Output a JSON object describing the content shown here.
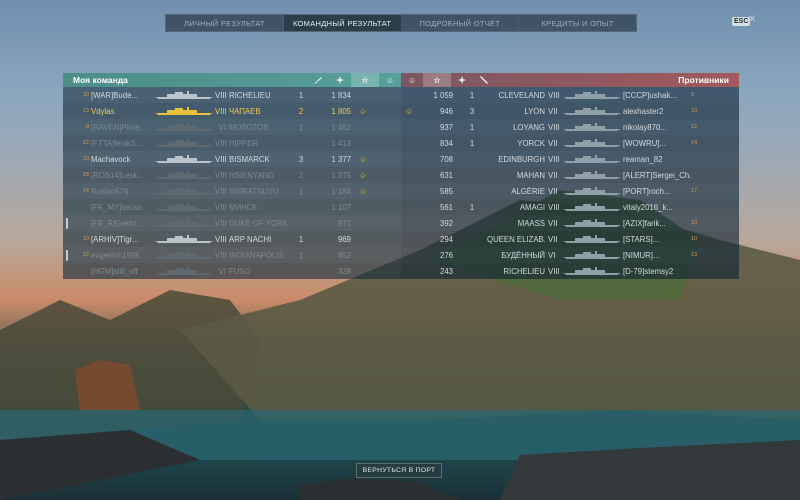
{
  "tabs": [
    "Личный результат",
    "Командный результат",
    "Подробный отчёт",
    "Кредиты и опыт"
  ],
  "esc_label": "ESC",
  "close_glyph": "✕",
  "colors": {
    "ally": "#57a09a",
    "enemy": "#a15a5e",
    "me": "#f0c94b"
  },
  "icons": {
    "kills": "torpedo-icon",
    "planes": "plane-icon",
    "xp": "star-icon",
    "medal": "medal-icon"
  },
  "my_team": {
    "title": "Моя команда",
    "rows": [
      {
        "level": "10",
        "player": "[WAR]Bude...",
        "tier": "VIII",
        "ship": "RICHELIEU",
        "kills": "1",
        "xp": "1 834",
        "medal": "",
        "me": false,
        "dead": false,
        "shield": false
      },
      {
        "level": "13",
        "player": "Vdylas",
        "tier": "VIII",
        "ship": "ЧАПАЕВ",
        "kills": "2",
        "xp": "1 805",
        "medal": "☺",
        "me": true,
        "dead": false,
        "shield": false
      },
      {
        "level": "8",
        "player": "[RAVEN]Piote...",
        "tier": "VI",
        "ship": "МОЛОТОВ",
        "kills": "1",
        "xp": "1 462",
        "medal": "",
        "me": false,
        "dead": true,
        "shield": false
      },
      {
        "level": "12",
        "player": "[FTTA]fenikS...",
        "tier": "VIII",
        "ship": "HIPPER",
        "kills": "",
        "xp": "1 413",
        "medal": "",
        "me": false,
        "dead": true,
        "shield": false
      },
      {
        "level": "10",
        "player": "Machavock",
        "tier": "VIII",
        "ship": "BISMARCK",
        "kills": "3",
        "xp": "1 377",
        "medal": "☺",
        "me": false,
        "dead": false,
        "shield": false
      },
      {
        "level": "15",
        "player": "[ROS14]Lesk...",
        "tier": "VIII",
        "ship": "HSIENYANG",
        "kills": "2",
        "xp": "1 275",
        "medal": "☺",
        "me": false,
        "dead": true,
        "shield": false
      },
      {
        "level": "14",
        "player": "Ruslan576",
        "tier": "VIII",
        "ship": "SHIRATSUYU",
        "kills": "1",
        "xp": "1 184",
        "medal": "☺",
        "me": false,
        "dead": true,
        "shield": false
      },
      {
        "level": "",
        "player": "[FK_MY]secsic",
        "tier": "VIII",
        "ship": "МИНСК",
        "kills": "",
        "xp": "1 107",
        "medal": "",
        "me": false,
        "dead": true,
        "shield": false
      },
      {
        "level": "",
        "player": "[FB_R]Gekto...",
        "tier": "VIII",
        "ship": "DUKE OF YORK",
        "kills": "",
        "xp": "971",
        "medal": "",
        "me": false,
        "dead": true,
        "shield": true
      },
      {
        "level": "10",
        "player": "[ARHIV]Tigr...",
        "tier": "VIII",
        "ship": "ARP NACHI",
        "kills": "1",
        "xp": "969",
        "medal": "",
        "me": false,
        "dead": false,
        "shield": false
      },
      {
        "level": "22",
        "player": "evgenich1985",
        "tier": "VIII",
        "ship": "INDIANAPOLIS",
        "kills": "1",
        "xp": "852",
        "medal": "",
        "me": false,
        "dead": true,
        "shield": true
      },
      {
        "level": "",
        "player": "[HGM]still_off",
        "tier": "VI",
        "ship": "FUSO",
        "kills": "",
        "xp": "328",
        "medal": "",
        "me": false,
        "dead": true,
        "shield": false
      }
    ]
  },
  "enemies": {
    "title": "Противники",
    "rows": [
      {
        "medal": "",
        "xp": "1 059",
        "kills": "1",
        "ship": "CLEVELAND",
        "tier": "VIII",
        "player": "[CCCP]ushak...",
        "level": "5"
      },
      {
        "medal": "☺",
        "xp": "946",
        "kills": "3",
        "ship": "LYON",
        "tier": "VII",
        "player": "alexhaster2",
        "level": "10"
      },
      {
        "medal": "",
        "xp": "937",
        "kills": "1",
        "ship": "LOYANG",
        "tier": "VIII",
        "player": "nikolay870...",
        "level": "12"
      },
      {
        "medal": "",
        "xp": "834",
        "kills": "1",
        "ship": "YORCK",
        "tier": "VII",
        "player": "[WOWRU]...",
        "level": "14"
      },
      {
        "medal": "",
        "xp": "708",
        "kills": "",
        "ship": "EDINBURGH",
        "tier": "VIII",
        "player": "reaman_82",
        "level": ""
      },
      {
        "medal": "",
        "xp": "631",
        "kills": "",
        "ship": "MAHAN",
        "tier": "VII",
        "player": "[ALERT]Sergei_Ch...",
        "level": ""
      },
      {
        "medal": "",
        "xp": "585",
        "kills": "",
        "ship": "ALGÉRIE",
        "tier": "VII",
        "player": "[PORT]roch...",
        "level": "17"
      },
      {
        "medal": "",
        "xp": "561",
        "kills": "1",
        "ship": "AMAGI",
        "tier": "VIII",
        "player": "vitaly2016_k...",
        "level": ""
      },
      {
        "medal": "",
        "xp": "392",
        "kills": "",
        "ship": "MAASS",
        "tier": "VII",
        "player": "[AZIX]farik...",
        "level": "10"
      },
      {
        "medal": "",
        "xp": "294",
        "kills": "",
        "ship": "QUEEN ELIZAB...",
        "tier": "VII",
        "player": "[STARS]...",
        "level": "10"
      },
      {
        "medal": "",
        "xp": "276",
        "kills": "",
        "ship": "БУДЁННЫЙ",
        "tier": "VI",
        "player": "[NIMUR]...",
        "level": "13"
      },
      {
        "medal": "",
        "xp": "243",
        "kills": "",
        "ship": "RICHELIEU",
        "tier": "VIII",
        "player": "[D-79]stemsy2",
        "level": ""
      }
    ]
  },
  "back_button": "Вернуться в порт"
}
